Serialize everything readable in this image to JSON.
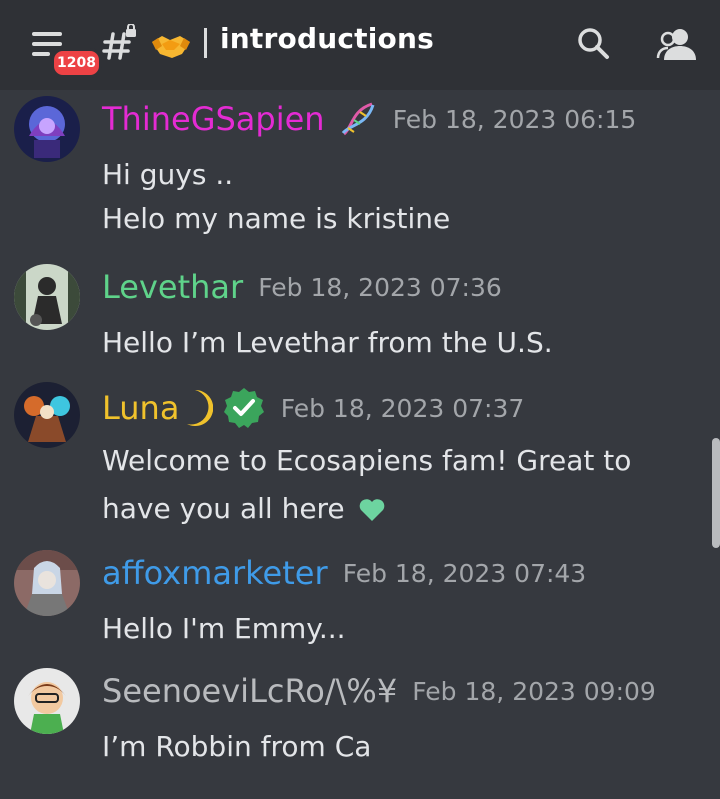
{
  "header": {
    "notification_count": "1208",
    "channel_name": "introductions",
    "colors": {
      "bar_bg": "#2f3136",
      "badge": "#ed4245"
    }
  },
  "messages": [
    {
      "username": "ThineGSapien",
      "username_color": "#e42bd3",
      "timestamp": "Feb 18, 2023 06:15",
      "lines": [
        "Hi guys ..",
        "Helo my name is kristine"
      ],
      "badge_icon": "dna-icon"
    },
    {
      "username": "Levethar",
      "username_color": "#5fd38a",
      "timestamp": "Feb 18, 2023 07:36",
      "lines": [
        "Hello I’m Levethar from the U.S."
      ]
    },
    {
      "username": "Luna",
      "username_color": "#f0c22c",
      "timestamp": "Feb 18, 2023 07:37",
      "lines": [
        "Welcome to Ecosapiens fam! Great to",
        "have you all here"
      ],
      "badge_icon": "verified-icon"
    },
    {
      "username": "affoxmarketer",
      "username_color": "#3f9be8",
      "timestamp": "Feb 18, 2023 07:43",
      "lines": [
        "Hello I'm Emmy..."
      ]
    },
    {
      "username": "SeenoeviLcRo/\\%¥",
      "username_color": "#b9bbbe",
      "timestamp": "Feb 18, 2023 09:09",
      "lines": [
        "I’m Robbin from Ca"
      ]
    }
  ]
}
